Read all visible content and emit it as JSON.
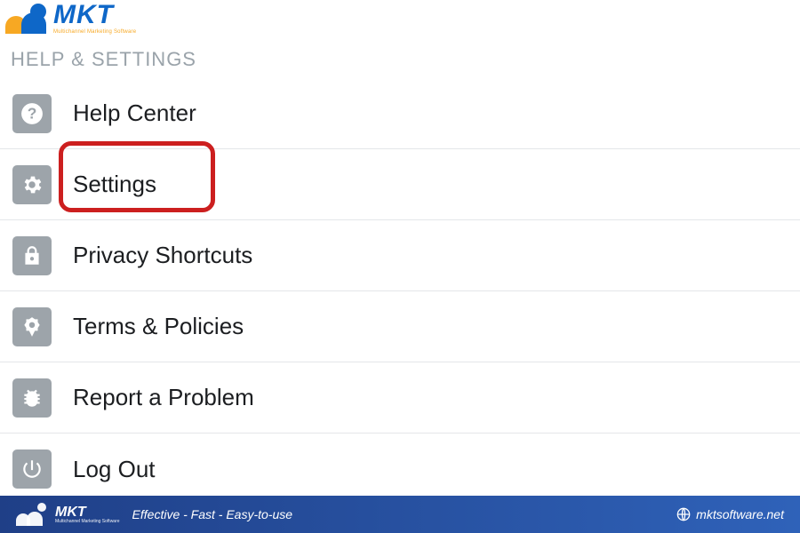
{
  "brand": {
    "name": "MKT",
    "tagline": "Multichannel Marketing Software"
  },
  "section": {
    "title": "HELP & SETTINGS"
  },
  "menu": {
    "items": [
      {
        "icon": "question-icon",
        "label": "Help Center"
      },
      {
        "icon": "gear-icon",
        "label": "Settings"
      },
      {
        "icon": "lock-icon",
        "label": "Privacy Shortcuts"
      },
      {
        "icon": "ribbon-icon",
        "label": "Terms & Policies"
      },
      {
        "icon": "bug-icon",
        "label": "Report a Problem"
      },
      {
        "icon": "power-icon",
        "label": "Log Out"
      }
    ],
    "highlighted_index": 1
  },
  "footer": {
    "brand": "MKT",
    "brand_sub": "Multichannel Marketing Software",
    "slogan": "Effective - Fast - Easy-to-use",
    "site": "mktsoftware.net"
  },
  "colors": {
    "brand_blue": "#0e67c8",
    "brand_orange": "#f7a823",
    "highlight_red": "#cc1f1f",
    "icon_grey": "#9da4aa"
  }
}
